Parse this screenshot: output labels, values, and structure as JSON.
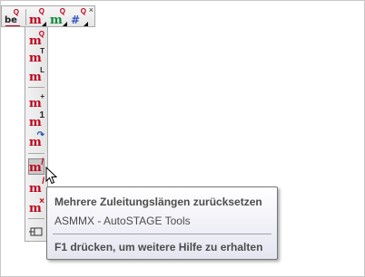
{
  "toolbar_top": {
    "buttons": [
      {
        "icon": "be-q-icon",
        "text": "be",
        "sup": "Q"
      },
      {
        "icon": "m-q-icon",
        "text": "m",
        "sup": "Q"
      },
      {
        "icon": "m-q-green-icon",
        "text": "m",
        "sup": "Q"
      },
      {
        "icon": "hash-q-icon",
        "text": "#",
        "sup": "Q"
      }
    ],
    "close_glyph": "×"
  },
  "toolbar_vertical": {
    "buttons": [
      {
        "icon": "m-q-icon",
        "sup": "Q"
      },
      {
        "icon": "m-t-icon",
        "sup": "T"
      },
      {
        "icon": "m-l-icon",
        "sup": "L"
      },
      {
        "icon": "m-plus-icon",
        "sup": "+"
      },
      {
        "icon": "m-1-icon",
        "sup": "1"
      },
      {
        "icon": "m-rotate-icon",
        "sup": "↷"
      },
      {
        "icon": "m-reset-lengths-icon",
        "sup": "/"
      },
      {
        "icon": "m-draw-icon",
        "sup": "/"
      },
      {
        "icon": "m-cross-icon",
        "sup": "×"
      },
      {
        "icon": "dock-icon",
        "sup": ""
      }
    ]
  },
  "tooltip": {
    "title": "Mehrere Zuleitungslängen zurücksetzen",
    "description": "ASMMX - AutoSTAGE Tools",
    "help": "F1 drücken, um weitere Hilfe zu erhalten"
  },
  "colors": {
    "icon_red": "#c0001a",
    "tooltip_text": "#4c4c4c"
  }
}
